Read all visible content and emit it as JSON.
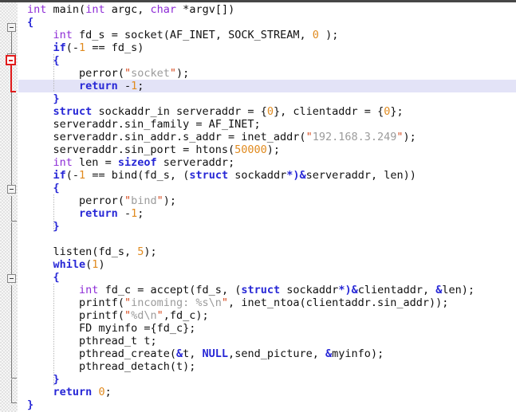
{
  "editor": {
    "title": "code-editor-pane",
    "language": "C",
    "colors": {
      "background": "#ffffff",
      "gutter": "#f7f7f7",
      "current_line_highlight": "#e3e3f7",
      "keyword": "#2727d6",
      "type": "#8d2bd6",
      "number": "#e08a1e",
      "string": "#9b9b9b",
      "quote": "#d64a1e",
      "fold_marker": "#868686",
      "fold_marker_active": "#e01b1b",
      "text": "#111111"
    },
    "highlighted_line_number": 7
  },
  "gutter": {
    "fold_markers": [
      {
        "name": "fold-marker-main-body",
        "line": 2,
        "state": "expanded",
        "color": "#868686"
      },
      {
        "name": "fold-marker-if-socket",
        "line": 5,
        "state": "expanded",
        "color": "#e01b1b"
      },
      {
        "name": "fold-marker-if-bind",
        "line": 15,
        "state": "expanded",
        "color": "#868686"
      },
      {
        "name": "fold-marker-while-body",
        "line": 22,
        "state": "expanded",
        "color": "#868686"
      }
    ]
  },
  "code": {
    "lines": [
      {
        "n": 1,
        "indent": 0,
        "text": "int main(int argc, char *argv[])"
      },
      {
        "n": 2,
        "indent": 0,
        "text": "{"
      },
      {
        "n": 3,
        "indent": 1,
        "text": "int fd_s = socket(AF_INET, SOCK_STREAM, 0 );"
      },
      {
        "n": 4,
        "indent": 1,
        "text": "if(-1 == fd_s)"
      },
      {
        "n": 5,
        "indent": 1,
        "text": "{"
      },
      {
        "n": 6,
        "indent": 2,
        "text": "perror(\"socket\");"
      },
      {
        "n": 7,
        "indent": 2,
        "text": "return -1;"
      },
      {
        "n": 8,
        "indent": 1,
        "text": "}"
      },
      {
        "n": 9,
        "indent": 1,
        "text": "struct sockaddr_in serveraddr = {0}, clientaddr = {0};"
      },
      {
        "n": 10,
        "indent": 1,
        "text": "serveraddr.sin_family = AF_INET;"
      },
      {
        "n": 11,
        "indent": 1,
        "text": "serveraddr.sin_addr.s_addr = inet_addr(\"192.168.3.249\");"
      },
      {
        "n": 12,
        "indent": 1,
        "text": "serveraddr.sin_port = htons(50000);"
      },
      {
        "n": 13,
        "indent": 1,
        "text": "int len = sizeof serveraddr;"
      },
      {
        "n": 14,
        "indent": 1,
        "text": "if(-1 == bind(fd_s, (struct sockaddr*)&serveraddr, len))"
      },
      {
        "n": 15,
        "indent": 1,
        "text": "{"
      },
      {
        "n": 16,
        "indent": 2,
        "text": "perror(\"bind\");"
      },
      {
        "n": 17,
        "indent": 2,
        "text": "return -1;"
      },
      {
        "n": 18,
        "indent": 1,
        "text": "}"
      },
      {
        "n": 19,
        "indent": 0,
        "text": ""
      },
      {
        "n": 20,
        "indent": 1,
        "text": "listen(fd_s, 5);"
      },
      {
        "n": 21,
        "indent": 1,
        "text": "while(1)"
      },
      {
        "n": 22,
        "indent": 1,
        "text": "{"
      },
      {
        "n": 23,
        "indent": 2,
        "text": "int fd_c = accept(fd_s, (struct sockaddr*)&clientaddr, &len);"
      },
      {
        "n": 24,
        "indent": 2,
        "text": "printf(\"incoming: %s\\n\", inet_ntoa(clientaddr.sin_addr));"
      },
      {
        "n": 25,
        "indent": 2,
        "text": "printf(\"%d\\n\",fd_c);"
      },
      {
        "n": 26,
        "indent": 2,
        "text": "FD myinfo ={fd_c};"
      },
      {
        "n": 27,
        "indent": 2,
        "text": "pthread_t t;"
      },
      {
        "n": 28,
        "indent": 2,
        "text": "pthread_create(&t, NULL,send_picture, &myinfo);"
      },
      {
        "n": 29,
        "indent": 2,
        "text": "pthread_detach(t);"
      },
      {
        "n": 30,
        "indent": 1,
        "text": "}"
      },
      {
        "n": 31,
        "indent": 1,
        "text": "return 0;"
      },
      {
        "n": 32,
        "indent": 0,
        "text": "}"
      }
    ]
  }
}
